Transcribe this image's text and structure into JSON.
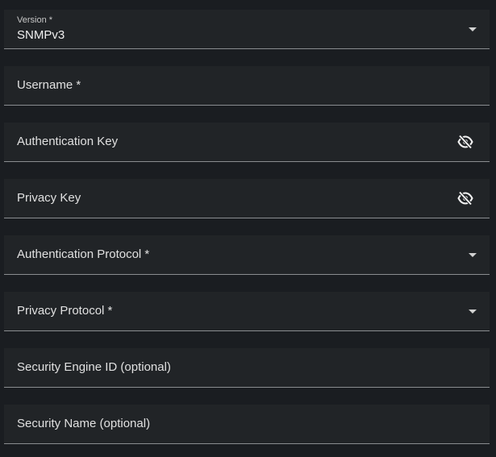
{
  "fields": {
    "version": {
      "label": "Version *",
      "value": "SNMPv3",
      "icon": "caret-down-icon"
    },
    "username": {
      "label": "Username *"
    },
    "auth_key": {
      "label": "Authentication Key",
      "icon": "eye-slash-icon"
    },
    "privacy_key": {
      "label": "Privacy Key",
      "icon": "eye-slash-icon"
    },
    "auth_protocol": {
      "label": "Authentication Protocol *",
      "icon": "caret-down-icon"
    },
    "privacy_protocol": {
      "label": "Privacy Protocol *",
      "icon": "caret-down-icon"
    },
    "security_engine_id": {
      "label": "Security Engine ID (optional)"
    },
    "security_name": {
      "label": "Security Name (optional)"
    }
  },
  "colors": {
    "background": "#1a1d21",
    "field_bg": "#212427",
    "underline": "#8a8d90",
    "text": "#e0e0e0"
  }
}
